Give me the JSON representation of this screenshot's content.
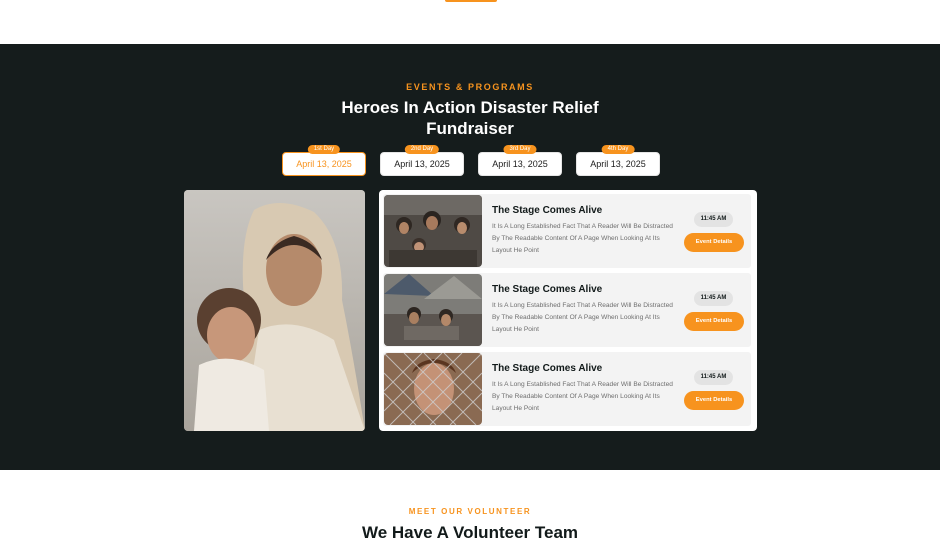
{
  "events": {
    "eyebrow": "EVENTS & PROGRAMS",
    "title_line1": "Heroes In Action Disaster Relief",
    "title_line2": "Fundraiser",
    "days": [
      {
        "tag": "1st Day",
        "date": "April 13, 2025",
        "active": true
      },
      {
        "tag": "2nd Day",
        "date": "April 13, 2025",
        "active": false
      },
      {
        "tag": "3rd Day",
        "date": "April 13, 2025",
        "active": false
      },
      {
        "tag": "4th Day",
        "date": "April 13, 2025",
        "active": false
      }
    ],
    "items": [
      {
        "title": "The Stage Comes Alive",
        "description": "It Is A Long Established Fact That A Reader Will Be Distracted By The Readable Content Of A Page When Looking At Its Layout He Point",
        "time": "11:45 AM",
        "button": "Event Details"
      },
      {
        "title": "The Stage Comes Alive",
        "description": "It Is A Long Established Fact That A Reader Will Be Distracted By The Readable Content Of A Page When Looking At Its Layout He Point",
        "time": "11:45 AM",
        "button": "Event Details"
      },
      {
        "title": "The Stage Comes Alive",
        "description": "It Is A Long Established Fact That A Reader Will Be Distracted By The Readable Content Of A Page When Looking At Its Layout He Point",
        "time": "11:45 AM",
        "button": "Event Details"
      }
    ]
  },
  "volunteer": {
    "eyebrow": "MEET OUR VOLUNTEER",
    "title": "We Have A Volunteer Team"
  },
  "colors": {
    "accent": "#f7931e",
    "dark_bg": "#151c1c"
  }
}
